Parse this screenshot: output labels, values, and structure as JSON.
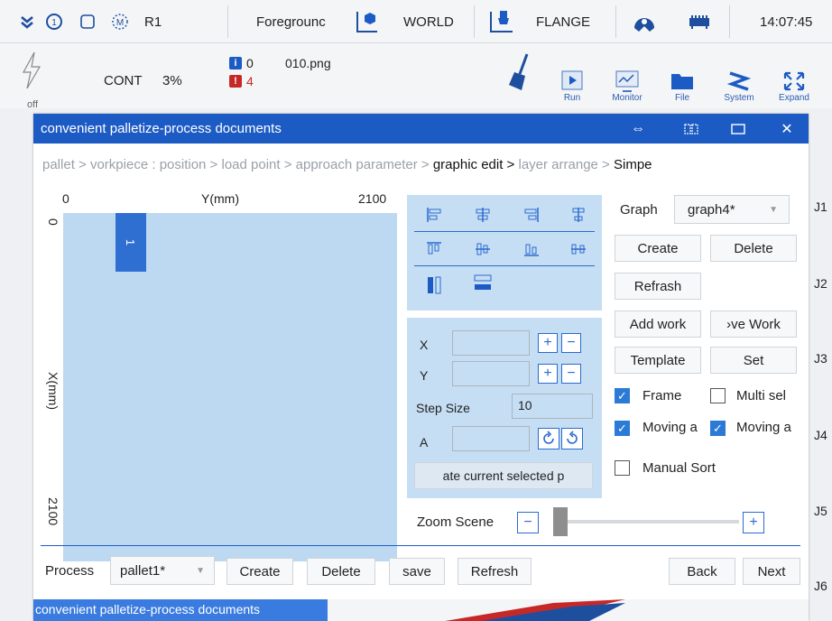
{
  "topbar": {
    "robot": "R1",
    "mode": "Foregrounc",
    "coord": "WORLD",
    "tool": "FLANGE",
    "time": "14:07:45"
  },
  "toolbar": {
    "power": "off",
    "cont": "CONT",
    "speed": "3%",
    "info_count": "0",
    "file": "010.png",
    "alarm_count": "4",
    "tools": [
      "Run",
      "Monitor",
      "File",
      "System",
      "Expand"
    ]
  },
  "dialog": {
    "title": "convenient palletize-process documents",
    "breadcrumb": [
      "pallet >",
      "vorkpiece :",
      "position >",
      "load point >",
      "approach parameter >",
      "graphic edit >",
      "layer arrange >",
      "Simpe"
    ],
    "canvas": {
      "x0": "0",
      "yaxis_label": "Y(mm)",
      "x_max": "2100",
      "y0": "0",
      "xaxis_label": "X(mm)",
      "y_max": "2100",
      "workpiece": "1"
    },
    "edit": {
      "x_label": "X",
      "y_label": "Y",
      "step_label": "Step Size",
      "step_value": "10",
      "a_label": "A",
      "update_button": "ate current selected p"
    },
    "zoom_label": "Zoom Scene",
    "zoom_level": 0.0,
    "graph": {
      "label": "Graph",
      "selected": "graph4*",
      "create": "Create",
      "delete": "Delete",
      "refresh": "Refrash",
      "add_work": "Add work",
      "remove_work": "›ve Work",
      "template": "Template",
      "set": "Set",
      "frame": "Frame",
      "multi": "Multi sel",
      "moving1": "Moving a",
      "moving2": "Moving a",
      "manual": "Manual Sort"
    },
    "bottom": {
      "process_label": "Process",
      "process_value": "pallet1*",
      "create": "Create",
      "delete": "Delete",
      "save": "save",
      "refresh": "Refresh",
      "back": "Back",
      "next": "Next"
    }
  },
  "joints": [
    "J1",
    "J2",
    "J3",
    "J4",
    "J5",
    "J6"
  ],
  "taskbar_title": "convenient palletize-process documents",
  "colors": {
    "accent": "#1d5bc4",
    "canvas": "#bcd9f1",
    "panel": "#c5def3",
    "check": "#2a7ad6"
  }
}
